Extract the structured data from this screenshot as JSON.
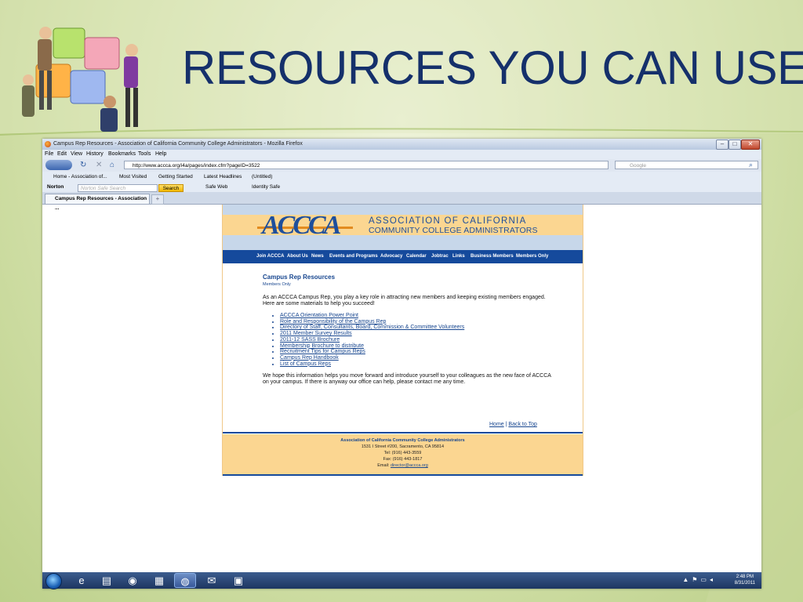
{
  "slide": {
    "title": "RESOURCES YOU CAN USE"
  },
  "browser": {
    "window_title": "Campus Rep Resources - Association of California Community College Administrators - Mozilla Firefox",
    "menu": [
      "File",
      "Edit",
      "View",
      "History",
      "Bookmarks",
      "Tools",
      "Help"
    ],
    "url": "http://www.accca.org/i4a/pages/index.cfm?pageID=3522",
    "search_placeholder": "Google",
    "bookmarks": [
      "Home - Association of...",
      "Most Visited",
      "Getting Started",
      "Latest Headlines",
      "(Untitled)"
    ],
    "norton": {
      "brand": "Norton",
      "search_placeholder": "Norton Safe Search",
      "search_button": "Search",
      "safe_web": "Safe Web",
      "identity_safe": "Identity Safe"
    },
    "tab_label": "Campus Rep Resources - Association ...",
    "new_tab": "+"
  },
  "site": {
    "logo": "ACCCA",
    "org_line1": "ASSOCIATION OF CALIFORNIA",
    "org_line2": "COMMUNITY COLLEGE ADMINISTRATORS",
    "nav": [
      "Join ACCCA",
      "About Us",
      "News",
      "Events and Programs",
      "Advocacy",
      "Calendar",
      "Jobtrac",
      "Links",
      "Business Members",
      "Members Only"
    ],
    "page_title": "Campus Rep Resources",
    "page_subtitle": "Members Only",
    "intro": "As an ACCCA Campus Rep, you play a key role in attracting new members and keeping existing members engaged. Here are some materials to help you succeed!",
    "links": [
      "ACCCA Orientation Power Point",
      "Role and Responsibility of the Campus Rep",
      "Directory of Staff, Consultants, Board, Commission & Committee Volunteers",
      "2011 Member Survey Results",
      "2011-12 SASS Brochure",
      "Membership Brochure to distribute",
      "Recruitment Tips for Campus Reps",
      "Campus Rep Handbook",
      "List of Campus Reps"
    ],
    "outro": "We hope this information helps you move forward and introduce yourself to your colleagues as the new face of ACCCA on your campus. If there is anyway our office can help, please contact me any time.",
    "home_link": "Home",
    "separator": "|",
    "back_to_top": "Back to Top",
    "footer": {
      "org": "Association of California Community College Administrators",
      "address": "1531 I Street #200, Sacramento, CA 95814",
      "tel": "Tel: (916) 443-3559",
      "fax": "Fax: (916) 443-1817",
      "email_label": "Email:",
      "email": "director@accca.org"
    }
  },
  "taskbar": {
    "time": "2:48 PM",
    "date": "8/31/2011"
  },
  "colors": {
    "title": "#15306b",
    "nav_blue": "#154a9c",
    "header_orange": "#fbd691",
    "link_blue": "#17468f"
  }
}
